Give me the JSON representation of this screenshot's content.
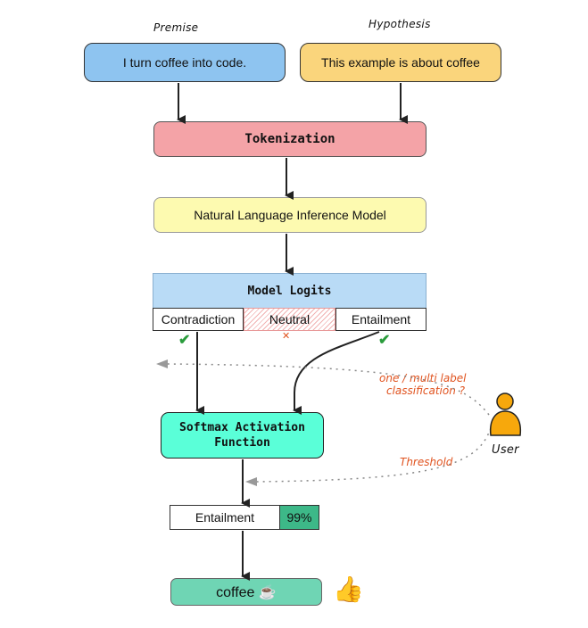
{
  "inputs": {
    "premise_label": "Premise",
    "premise_text": "I turn coffee into code.",
    "hypothesis_label": "Hypothesis",
    "hypothesis_text": "This example is about coffee"
  },
  "steps": {
    "tokenization": "Tokenization",
    "nli_model": "Natural Language Inference Model",
    "logits_title": "Model Logits",
    "logits": [
      {
        "label": "Contradiction",
        "status": "selected",
        "mark": "✔"
      },
      {
        "label": "Neutral",
        "status": "discarded",
        "mark": "✕"
      },
      {
        "label": "Entailment",
        "status": "selected",
        "mark": "✔"
      }
    ],
    "softmax_line1": "Softmax Activation",
    "softmax_line2": "Function"
  },
  "result": {
    "label": "Entailment",
    "score": "99%",
    "output_text": "coffee ☕",
    "thumbs_icon": "👍"
  },
  "user": {
    "label": "User",
    "note_multilabel_line1": "one / multi label",
    "note_multilabel_line2": "classification ?",
    "note_threshold": "Threshold"
  },
  "colors": {
    "premise": "#8ec4f0",
    "hypothesis": "#fad57c",
    "tokenization": "#f4a3a7",
    "nli": "#fdfab0",
    "logits_header": "#b9dbf6",
    "softmax": "#5affd8",
    "score": "#3db888",
    "output": "#6fd5b4",
    "user": "#f7a80c",
    "annotation": "#e0531f",
    "check": "#2a9c3c"
  }
}
